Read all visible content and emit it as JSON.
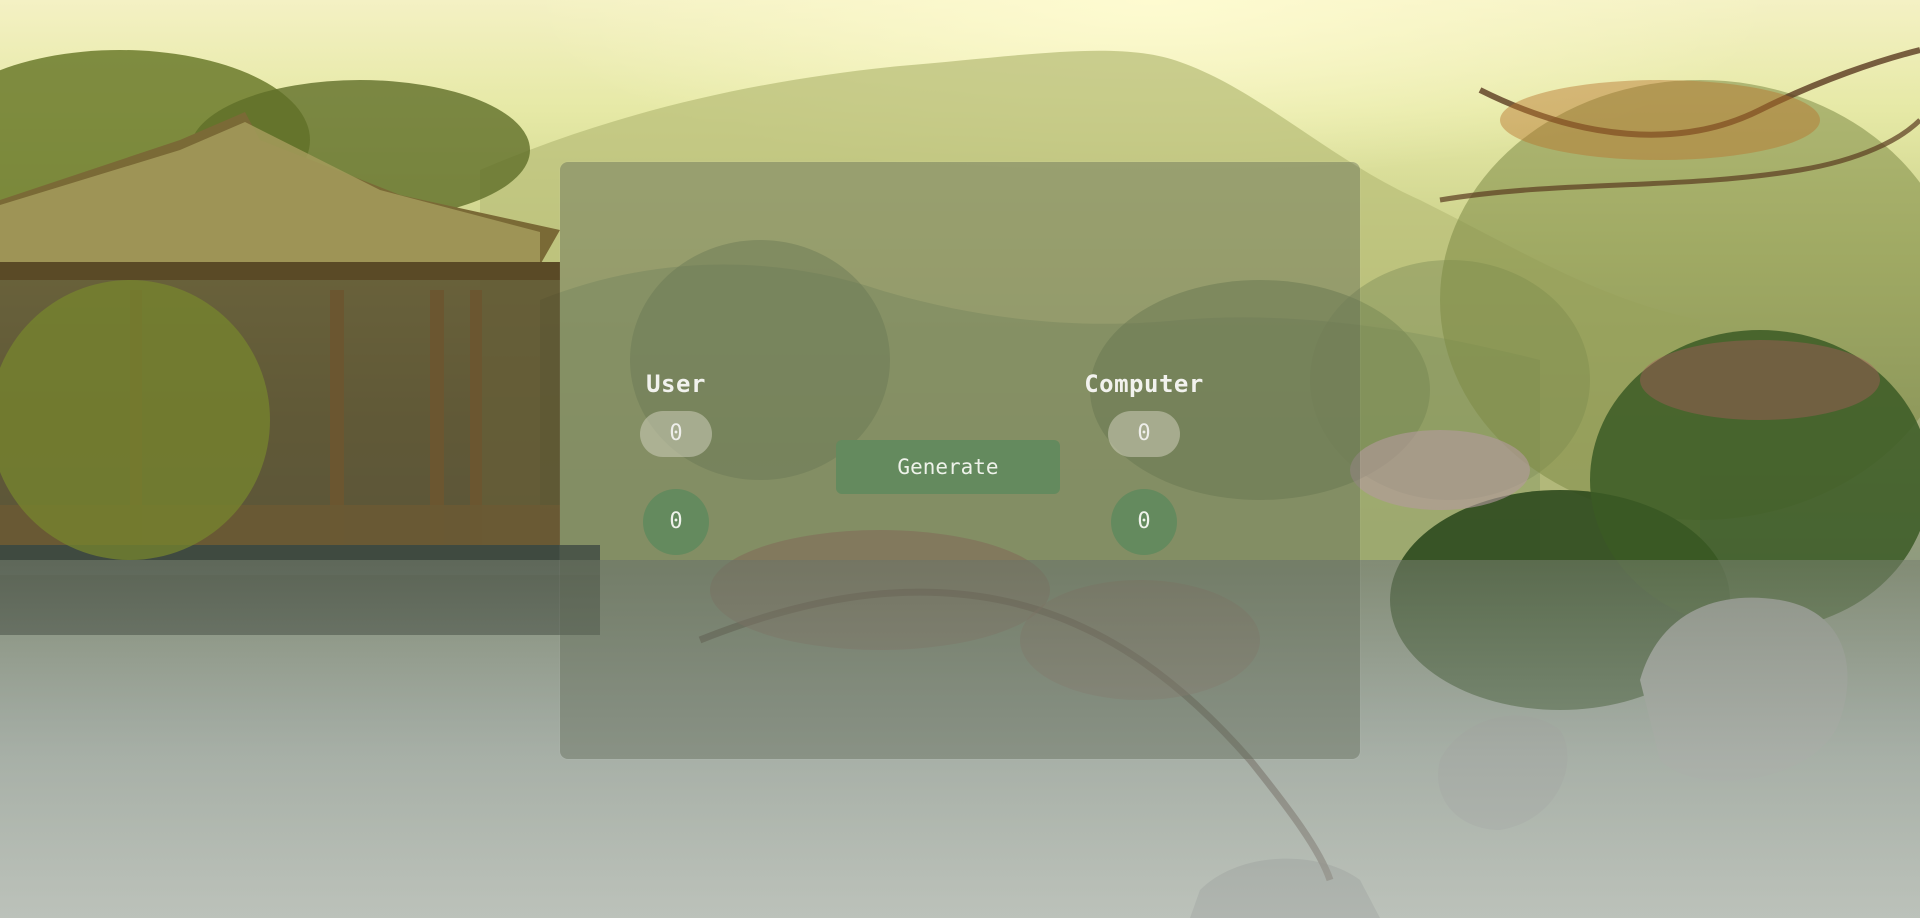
{
  "scoreboard": {
    "user": {
      "title": "User",
      "choice": "0",
      "score": "0"
    },
    "computer": {
      "title": "Computer",
      "choice": "0",
      "score": "0"
    },
    "generate_label": "Generate"
  },
  "colors": {
    "accent_green": "#648a5e",
    "pill_bg": "#cdcdb9",
    "panel_bg": "#5f6955"
  },
  "background": {
    "description_icon": "lake-pavilion-landscape"
  }
}
